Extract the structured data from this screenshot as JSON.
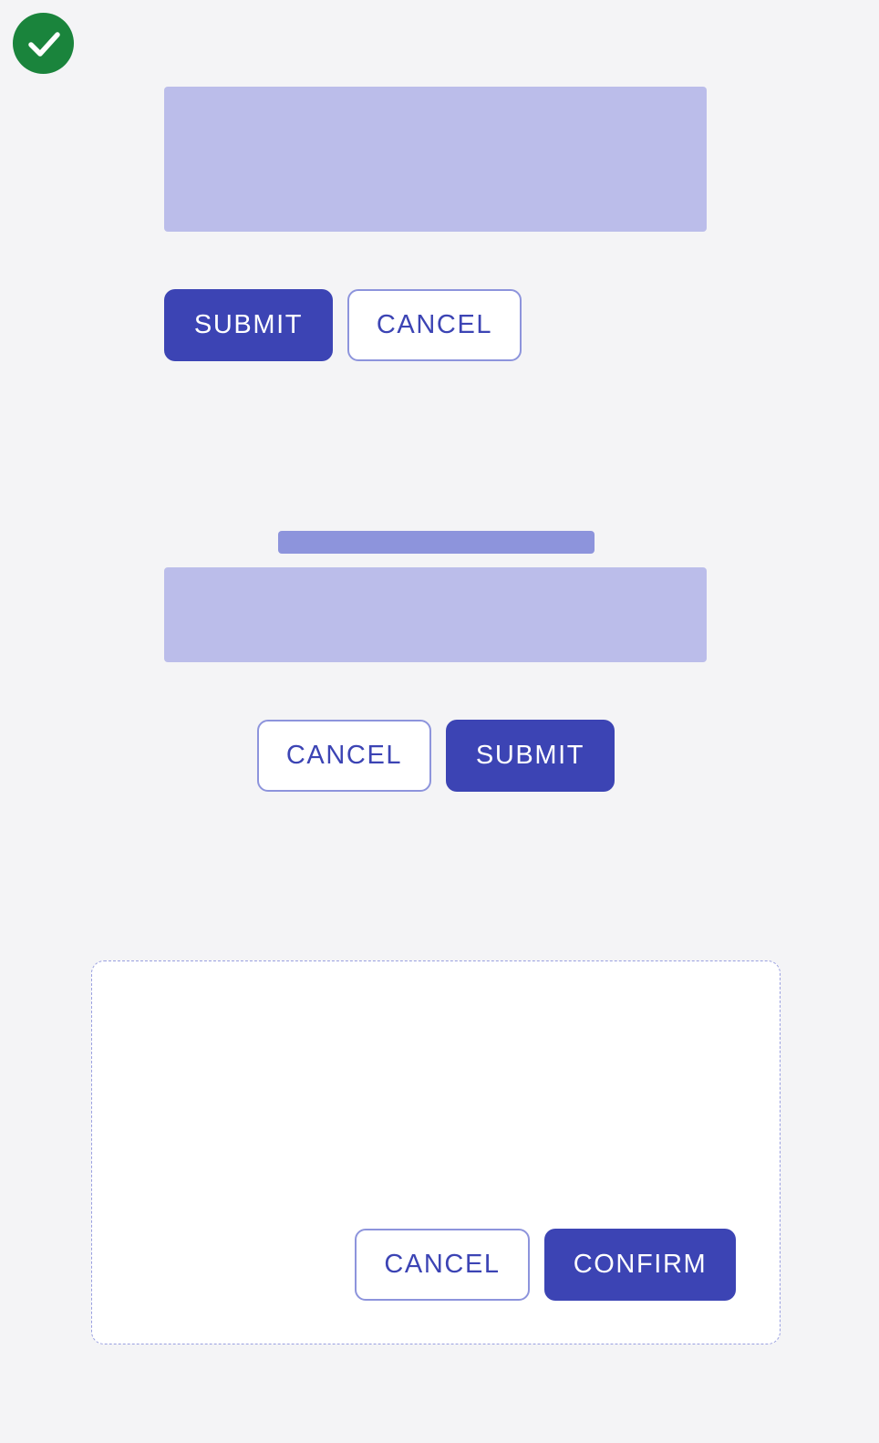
{
  "status": {
    "icon": "check-circle-icon",
    "color": "#1a843c"
  },
  "section_one": {
    "submit_label": "SUBMIT",
    "cancel_label": "CANCEL"
  },
  "section_two": {
    "cancel_label": "CANCEL",
    "submit_label": "SUBMIT"
  },
  "dialog": {
    "cancel_label": "CANCEL",
    "confirm_label": "CONFIRM"
  },
  "colors": {
    "primary": "#3c44b4",
    "placeholder": "#bbbdea",
    "placeholder_dark": "#8d94dc",
    "border": "#8d94dc",
    "background": "#f4f4f6",
    "success": "#1a843c"
  }
}
